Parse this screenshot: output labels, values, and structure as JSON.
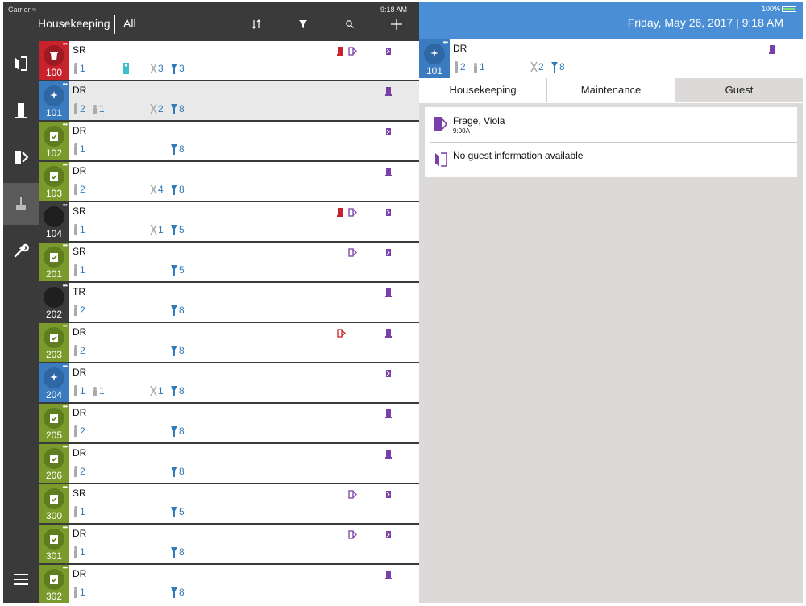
{
  "status": {
    "carrier": "Carrier",
    "time": "9:18 AM",
    "battery": "100%"
  },
  "header": {
    "title": "Housekeeping",
    "filter": "All"
  },
  "datetime": "Friday, May 26, 2017 | 9:18 AM",
  "tabs": [
    "Housekeeping",
    "Maintenance",
    "Guest"
  ],
  "selected_room": {
    "number": "101",
    "status": "DR",
    "guests": "2",
    "guests_secondary": "1",
    "maint": "2",
    "hk": "8"
  },
  "guest": {
    "name": "Frage, Viola",
    "time": "9:00A",
    "none": "No guest information available"
  },
  "colors": {
    "red": "#c8232c",
    "blue": "#3b7bbf",
    "green": "#7a9a2c",
    "dark": "#3b3b3b",
    "purple": "#7b3fa8",
    "accent_blue": "#4a8fd6"
  },
  "rooms": [
    {
      "number": "100",
      "status": "SR",
      "guests": "1",
      "maint": "3",
      "hk": "3"
    },
    {
      "number": "101",
      "status": "DR",
      "guests": "2",
      "guests2": "1",
      "maint": "2",
      "hk": "8"
    },
    {
      "number": "102",
      "status": "DR",
      "guests": "1",
      "hk": "8"
    },
    {
      "number": "103",
      "status": "DR",
      "guests": "2",
      "maint": "4",
      "hk": "8"
    },
    {
      "number": "104",
      "status": "SR",
      "guests": "1",
      "maint": "1",
      "hk": "5"
    },
    {
      "number": "201",
      "status": "SR",
      "guests": "1",
      "hk": "5"
    },
    {
      "number": "202",
      "status": "TR",
      "guests": "2",
      "hk": "8"
    },
    {
      "number": "203",
      "status": "DR",
      "guests": "2",
      "hk": "8"
    },
    {
      "number": "204",
      "status": "DR",
      "guests": "1",
      "guests2": "1",
      "maint": "1",
      "hk": "8"
    },
    {
      "number": "205",
      "status": "DR",
      "guests": "2",
      "hk": "8"
    },
    {
      "number": "206",
      "status": "DR",
      "guests": "2",
      "hk": "8"
    },
    {
      "number": "300",
      "status": "SR",
      "guests": "1",
      "hk": "5"
    },
    {
      "number": "301",
      "status": "DR",
      "guests": "1",
      "hk": "8"
    },
    {
      "number": "302",
      "status": "DR",
      "guests": "1",
      "hk": "8"
    }
  ]
}
